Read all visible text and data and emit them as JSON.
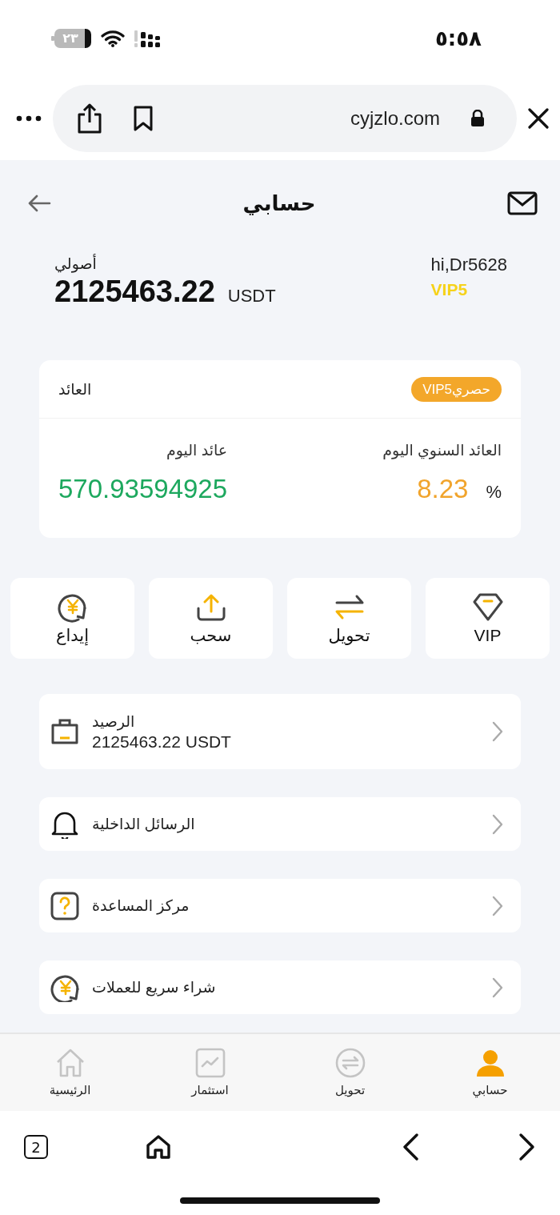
{
  "status_bar": {
    "time": "٥:٥٨",
    "battery": "٢٣"
  },
  "browser": {
    "url": "cyjzlo.com",
    "tab_count": "2"
  },
  "header": {
    "title": "حسابي"
  },
  "account": {
    "greeting": "hi,Dr5628",
    "vip_level": "VIP5",
    "assets_label": "أصولي",
    "assets_amount": "2125463.22",
    "assets_unit": "USDT"
  },
  "earnings_card": {
    "title": "العائد",
    "badge": "حصريVIP5",
    "annual_label": "العائد السنوي اليوم",
    "annual_value": "8.23",
    "annual_unit": "%",
    "today_label": "عائد اليوم",
    "today_value": "570.93594925"
  },
  "actions": [
    {
      "label": "VIP"
    },
    {
      "label": "تحويل"
    },
    {
      "label": "سحب"
    },
    {
      "label": "إيداع"
    }
  ],
  "menu": [
    {
      "title": "الرصيد",
      "value": "2125463.22 USDT"
    },
    {
      "title": "الرسائل الداخلية"
    },
    {
      "title": "مركز المساعدة"
    },
    {
      "title": "شراء سريع للعملات"
    }
  ],
  "tab_bar": [
    {
      "label": "حسابي",
      "selected": true
    },
    {
      "label": "تحويل",
      "selected": false
    },
    {
      "label": "استثمار",
      "selected": false
    },
    {
      "label": "الرئيسية",
      "selected": false
    }
  ]
}
